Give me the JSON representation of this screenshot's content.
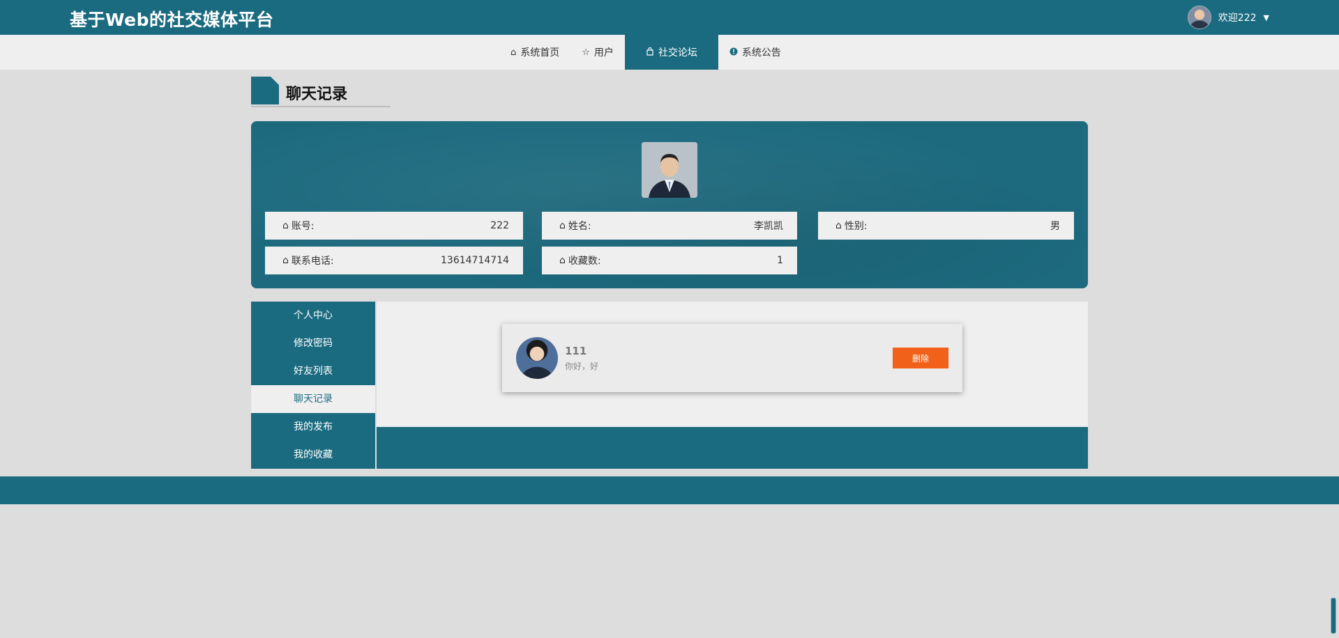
{
  "header": {
    "site_title": "基于Web的社交媒体平台",
    "welcome_text": "欢迎222",
    "caret": "▼"
  },
  "nav": {
    "items": [
      {
        "label": "系统首页",
        "icon": "home-icon"
      },
      {
        "label": "用户",
        "icon": "star-icon"
      },
      {
        "label": "社交论坛",
        "icon": "bag-icon"
      },
      {
        "label": "系统公告",
        "icon": "info-icon"
      }
    ],
    "active_index": 2
  },
  "section": {
    "title": "聊天记录"
  },
  "profile": {
    "fields": [
      {
        "label": "账号:",
        "value": "222"
      },
      {
        "label": "姓名:",
        "value": "李凯凯"
      },
      {
        "label": "性别:",
        "value": "男"
      },
      {
        "label": "联系电话:",
        "value": "13614714714"
      },
      {
        "label": "收藏数:",
        "value": "1"
      }
    ]
  },
  "side_menu": {
    "items": [
      "个人中心",
      "修改密码",
      "好友列表",
      "聊天记录",
      "我的发布",
      "我的收藏"
    ],
    "active_index": 3
  },
  "chat": {
    "name": "111",
    "message": "你好，好",
    "delete_label": "删除"
  },
  "colors": {
    "primary": "#1b6b80",
    "accent": "#f2611a",
    "nav_bg": "#efefef",
    "page_bg": "#dddddd"
  }
}
